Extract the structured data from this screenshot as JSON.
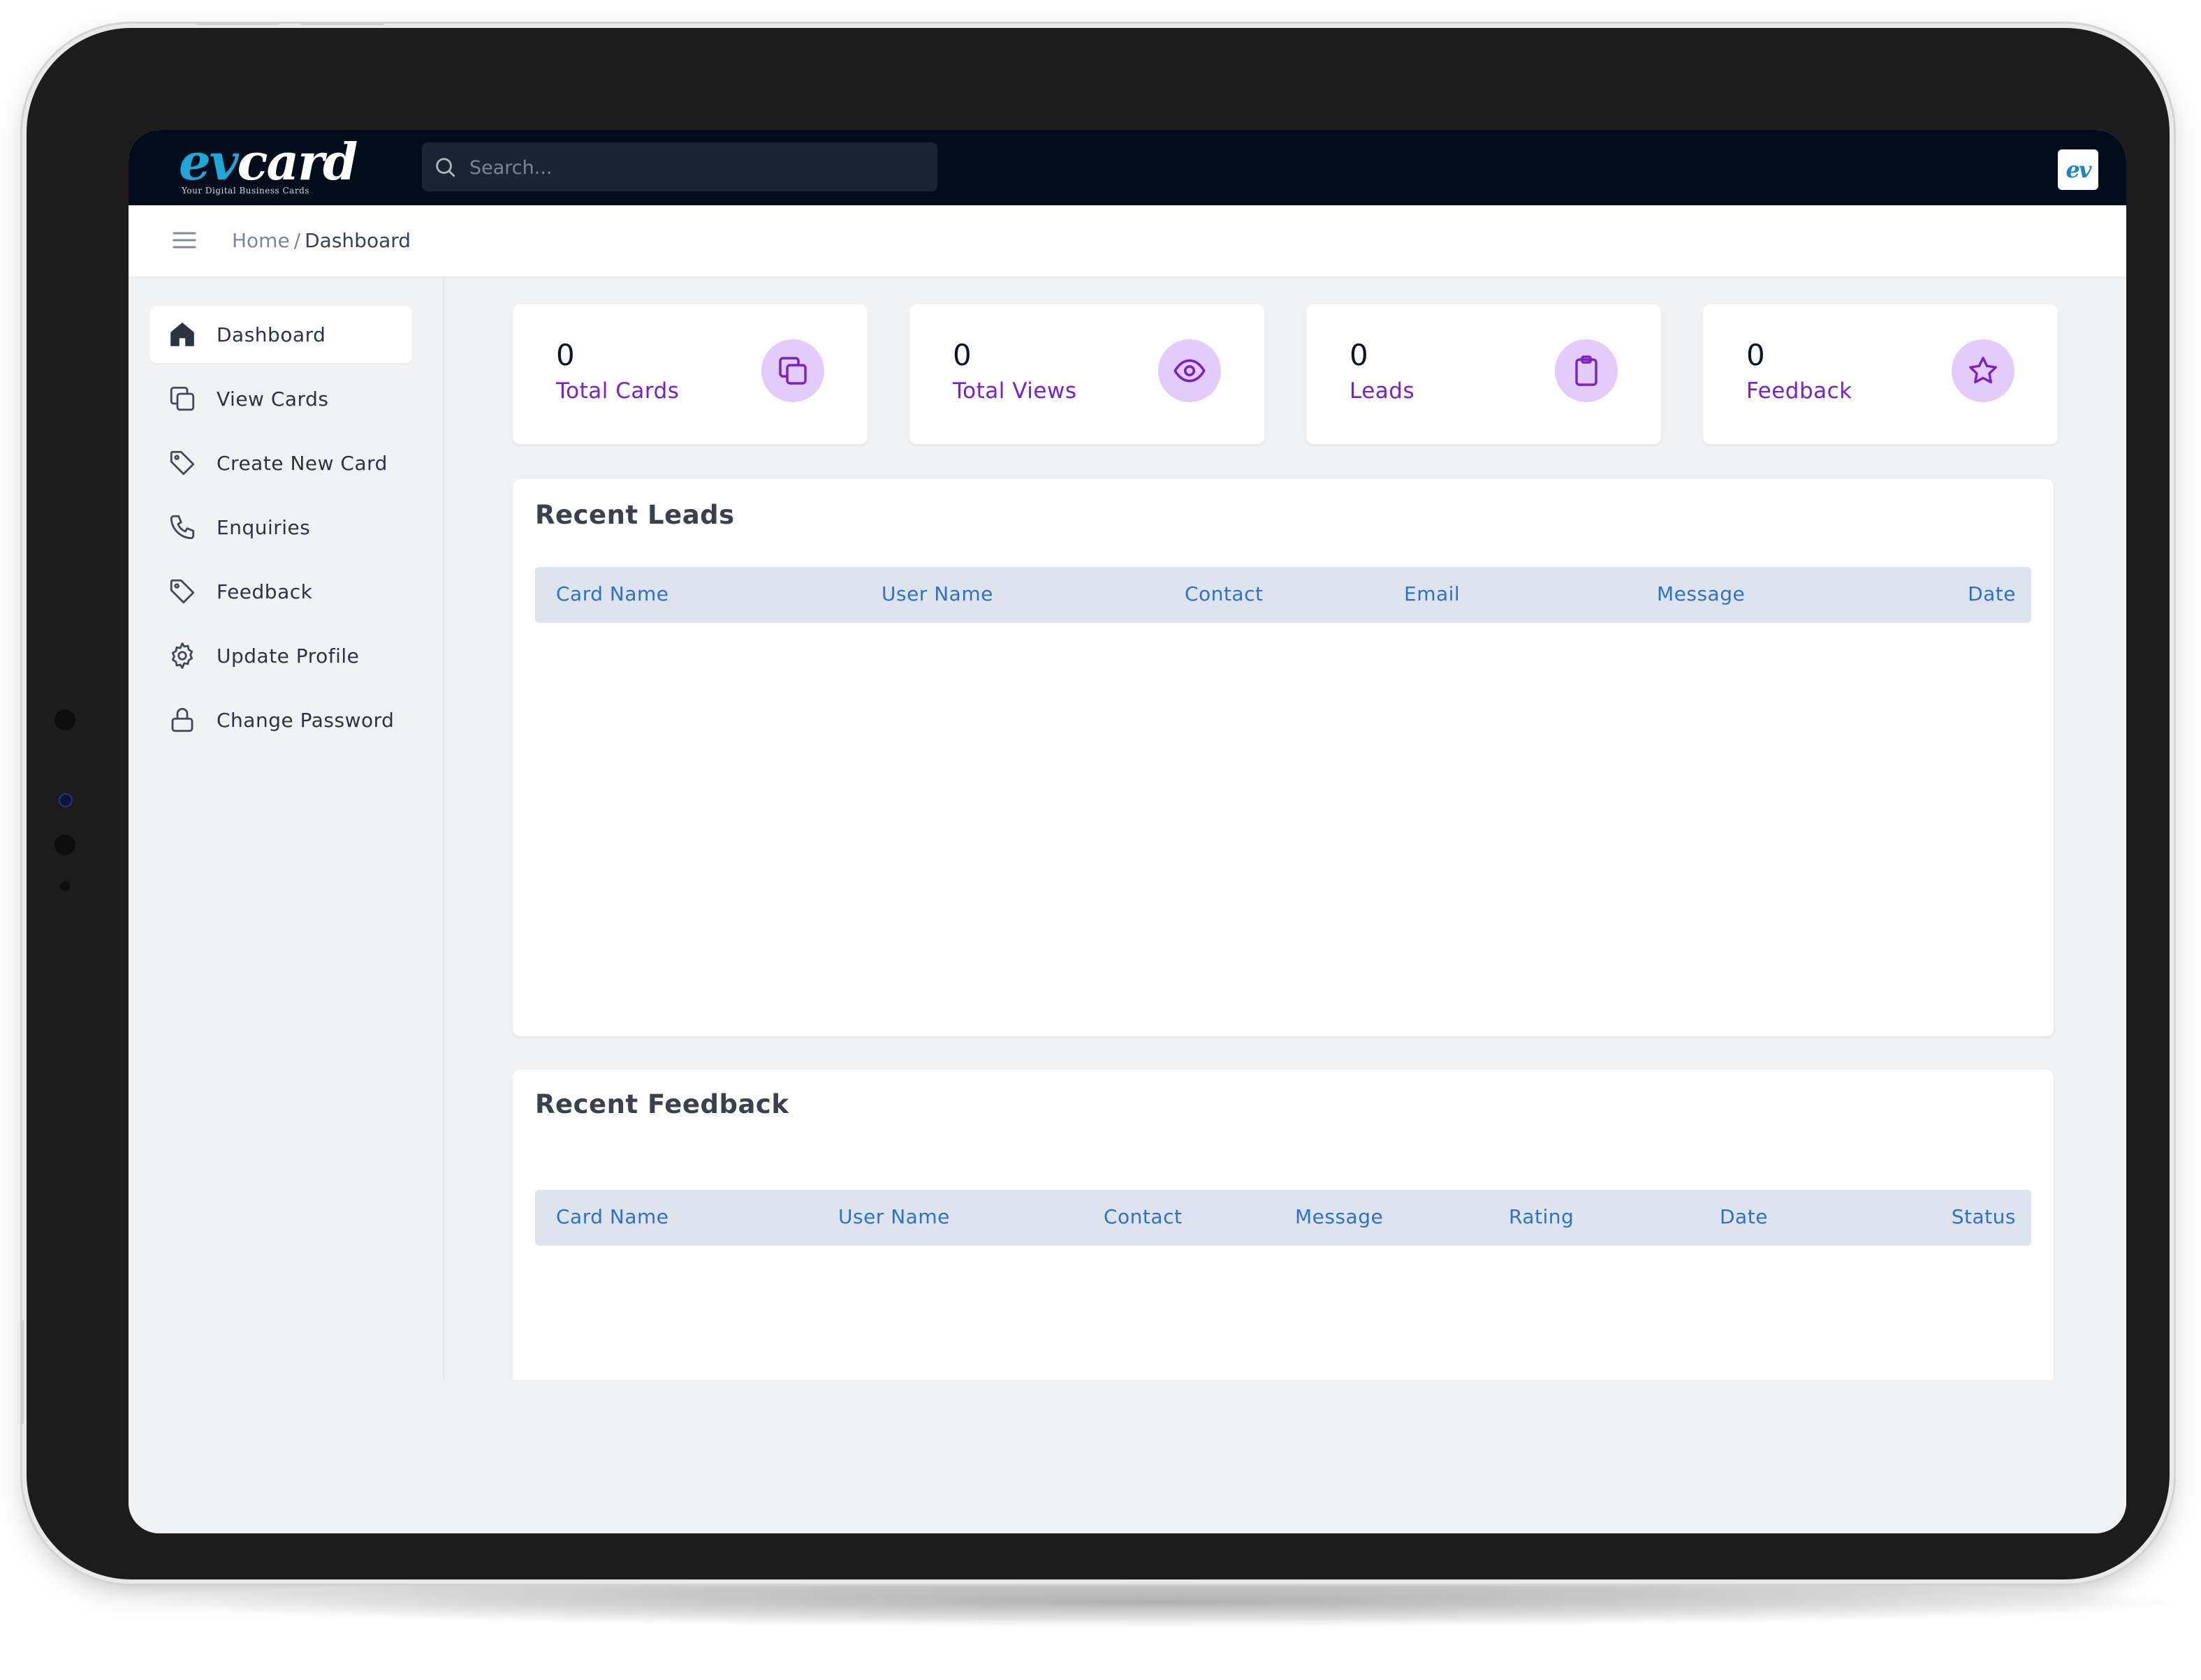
{
  "app": {
    "logo_text_accent": "ev",
    "logo_text_main": "card",
    "logo_tagline": "Your Digital Business Cards",
    "avatar_text": "ev"
  },
  "search": {
    "placeholder": "Search..."
  },
  "breadcrumb": {
    "home": "Home",
    "separator": "/",
    "current": "Dashboard"
  },
  "sidebar": {
    "items": [
      {
        "label": "Dashboard",
        "icon": "home-icon",
        "active": true
      },
      {
        "label": "View Cards",
        "icon": "copy-icon"
      },
      {
        "label": "Create New Card",
        "icon": "tag-icon"
      },
      {
        "label": "Enquiries",
        "icon": "phone-icon"
      },
      {
        "label": "Feedback",
        "icon": "tag-icon"
      },
      {
        "label": "Update Profile",
        "icon": "gear-icon"
      },
      {
        "label": "Change Password",
        "icon": "lock-icon"
      }
    ]
  },
  "stats": [
    {
      "value": "0",
      "label": "Total Cards",
      "icon": "copy-icon"
    },
    {
      "value": "0",
      "label": "Total Views",
      "icon": "eye-icon"
    },
    {
      "value": "0",
      "label": "Leads",
      "icon": "clipboard-icon"
    },
    {
      "value": "0",
      "label": "Feedback",
      "icon": "star-icon"
    }
  ],
  "recent_leads": {
    "title": "Recent Leads",
    "columns": [
      "Card Name",
      "User Name",
      "Contact",
      "Email",
      "Message",
      "Date"
    ],
    "rows": []
  },
  "recent_feedback": {
    "title": "Recent Feedback",
    "columns": [
      "Card Name",
      "User Name",
      "Contact",
      "Message",
      "Rating",
      "Date",
      "Status"
    ],
    "rows": []
  },
  "colors": {
    "navbar_bg": "#020c1b",
    "accent_purple": "#7a1fc9",
    "icon_circle_bg": "#e3ccfa",
    "table_header_bg": "#dde4ee",
    "table_header_text": "#3071c7",
    "logo_accent": "#1fa6d9"
  }
}
